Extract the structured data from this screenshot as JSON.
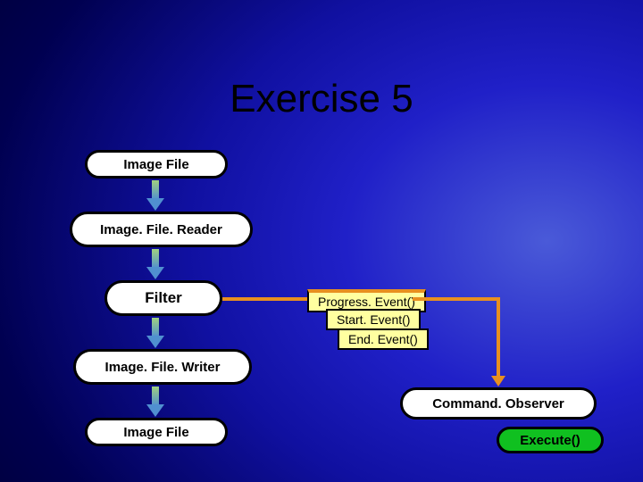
{
  "slide": {
    "title": "Exercise 5"
  },
  "nodes": {
    "image_file_top": "Image File",
    "reader": "Image. File. Reader",
    "filter": "Filter",
    "writer": "Image. File. Writer",
    "image_file_bottom": "Image File",
    "observer": "Command. Observer",
    "execute": "Execute()"
  },
  "events": {
    "progress": "Progress. Event()",
    "start": "Start. Event()",
    "end": "End. Event()"
  }
}
